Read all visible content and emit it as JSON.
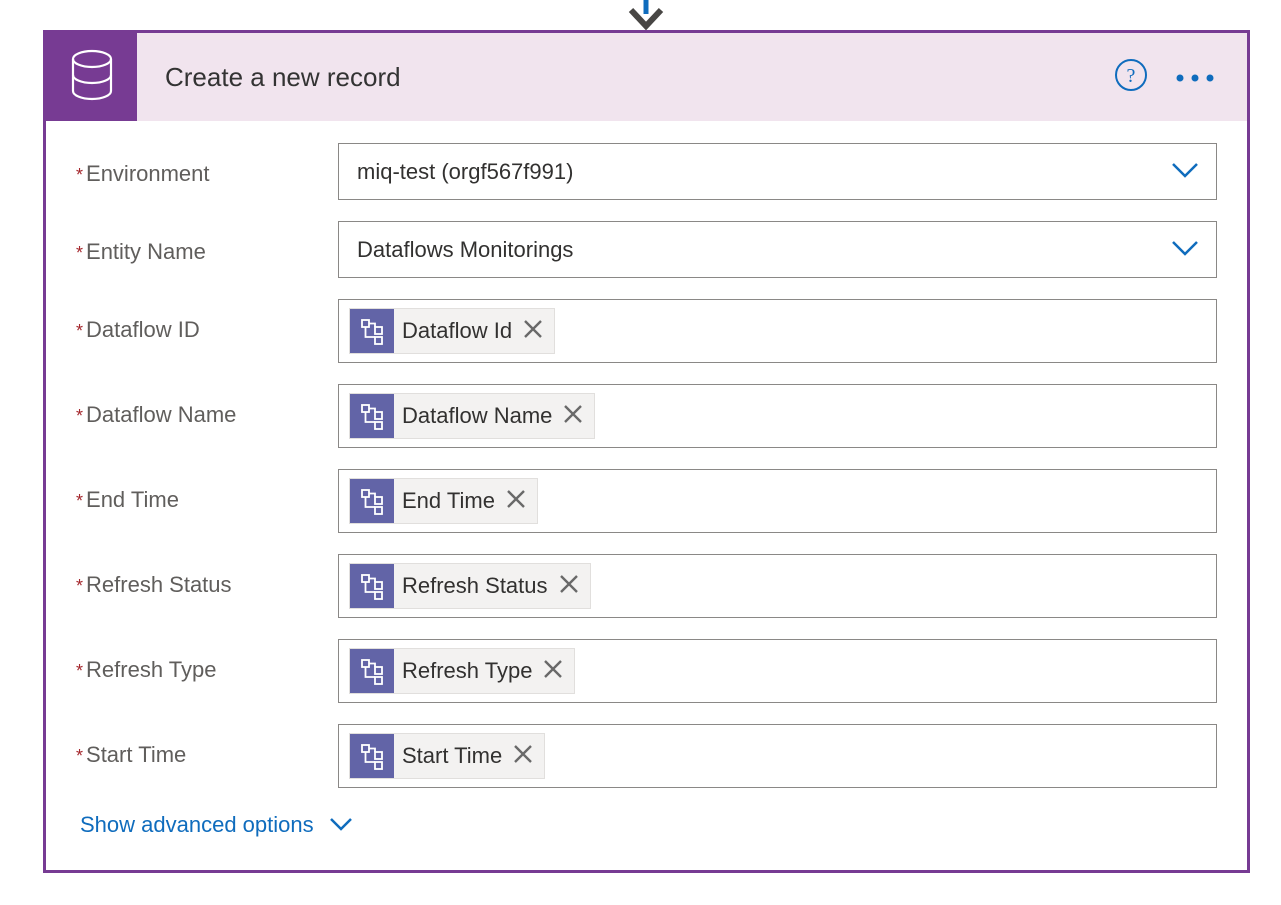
{
  "action": {
    "title": "Create a new record"
  },
  "fields": [
    {
      "key": "environment",
      "label": "Environment",
      "required": true,
      "type": "select",
      "value": "miq-test (orgf567f991)"
    },
    {
      "key": "entity_name",
      "label": "Entity Name",
      "required": true,
      "type": "select",
      "value": "Dataflows Monitorings"
    },
    {
      "key": "dataflow_id",
      "label": "Dataflow ID",
      "required": true,
      "type": "token",
      "token_label": "Dataflow Id"
    },
    {
      "key": "dataflow_name",
      "label": "Dataflow Name",
      "required": true,
      "type": "token",
      "token_label": "Dataflow Name"
    },
    {
      "key": "end_time",
      "label": "End Time",
      "required": true,
      "type": "token",
      "token_label": "End Time"
    },
    {
      "key": "refresh_status",
      "label": "Refresh Status",
      "required": true,
      "type": "token",
      "token_label": "Refresh Status"
    },
    {
      "key": "refresh_type",
      "label": "Refresh Type",
      "required": true,
      "type": "token",
      "token_label": "Refresh Type"
    },
    {
      "key": "start_time",
      "label": "Start Time",
      "required": true,
      "type": "token",
      "token_label": "Start Time"
    }
  ],
  "advanced_options_label": "Show advanced options"
}
